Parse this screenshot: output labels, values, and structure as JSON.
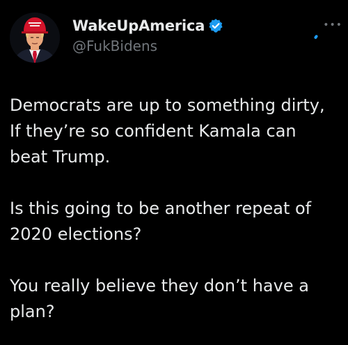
{
  "tweet": {
    "display_name": "WakeUpAmerica",
    "handle": "@FukBidens",
    "verified_icon": "verified-badge-icon",
    "more_icon": "more-options-icon",
    "paragraphs": [
      {
        "lines": [
          "Democrats are up to something dirty,",
          "If they’re so confident Kamala can",
          "beat Trump."
        ]
      },
      {
        "lines": [
          "Is this going to be another repeat of",
          "2020 elections?"
        ]
      },
      {
        "lines": [
          "You really believe they don’t have a",
          "plan?"
        ]
      }
    ]
  },
  "colors": {
    "background": "#000000",
    "text": "#e7e9ea",
    "secondary": "#71767b",
    "accent": "#1d9bf0"
  }
}
